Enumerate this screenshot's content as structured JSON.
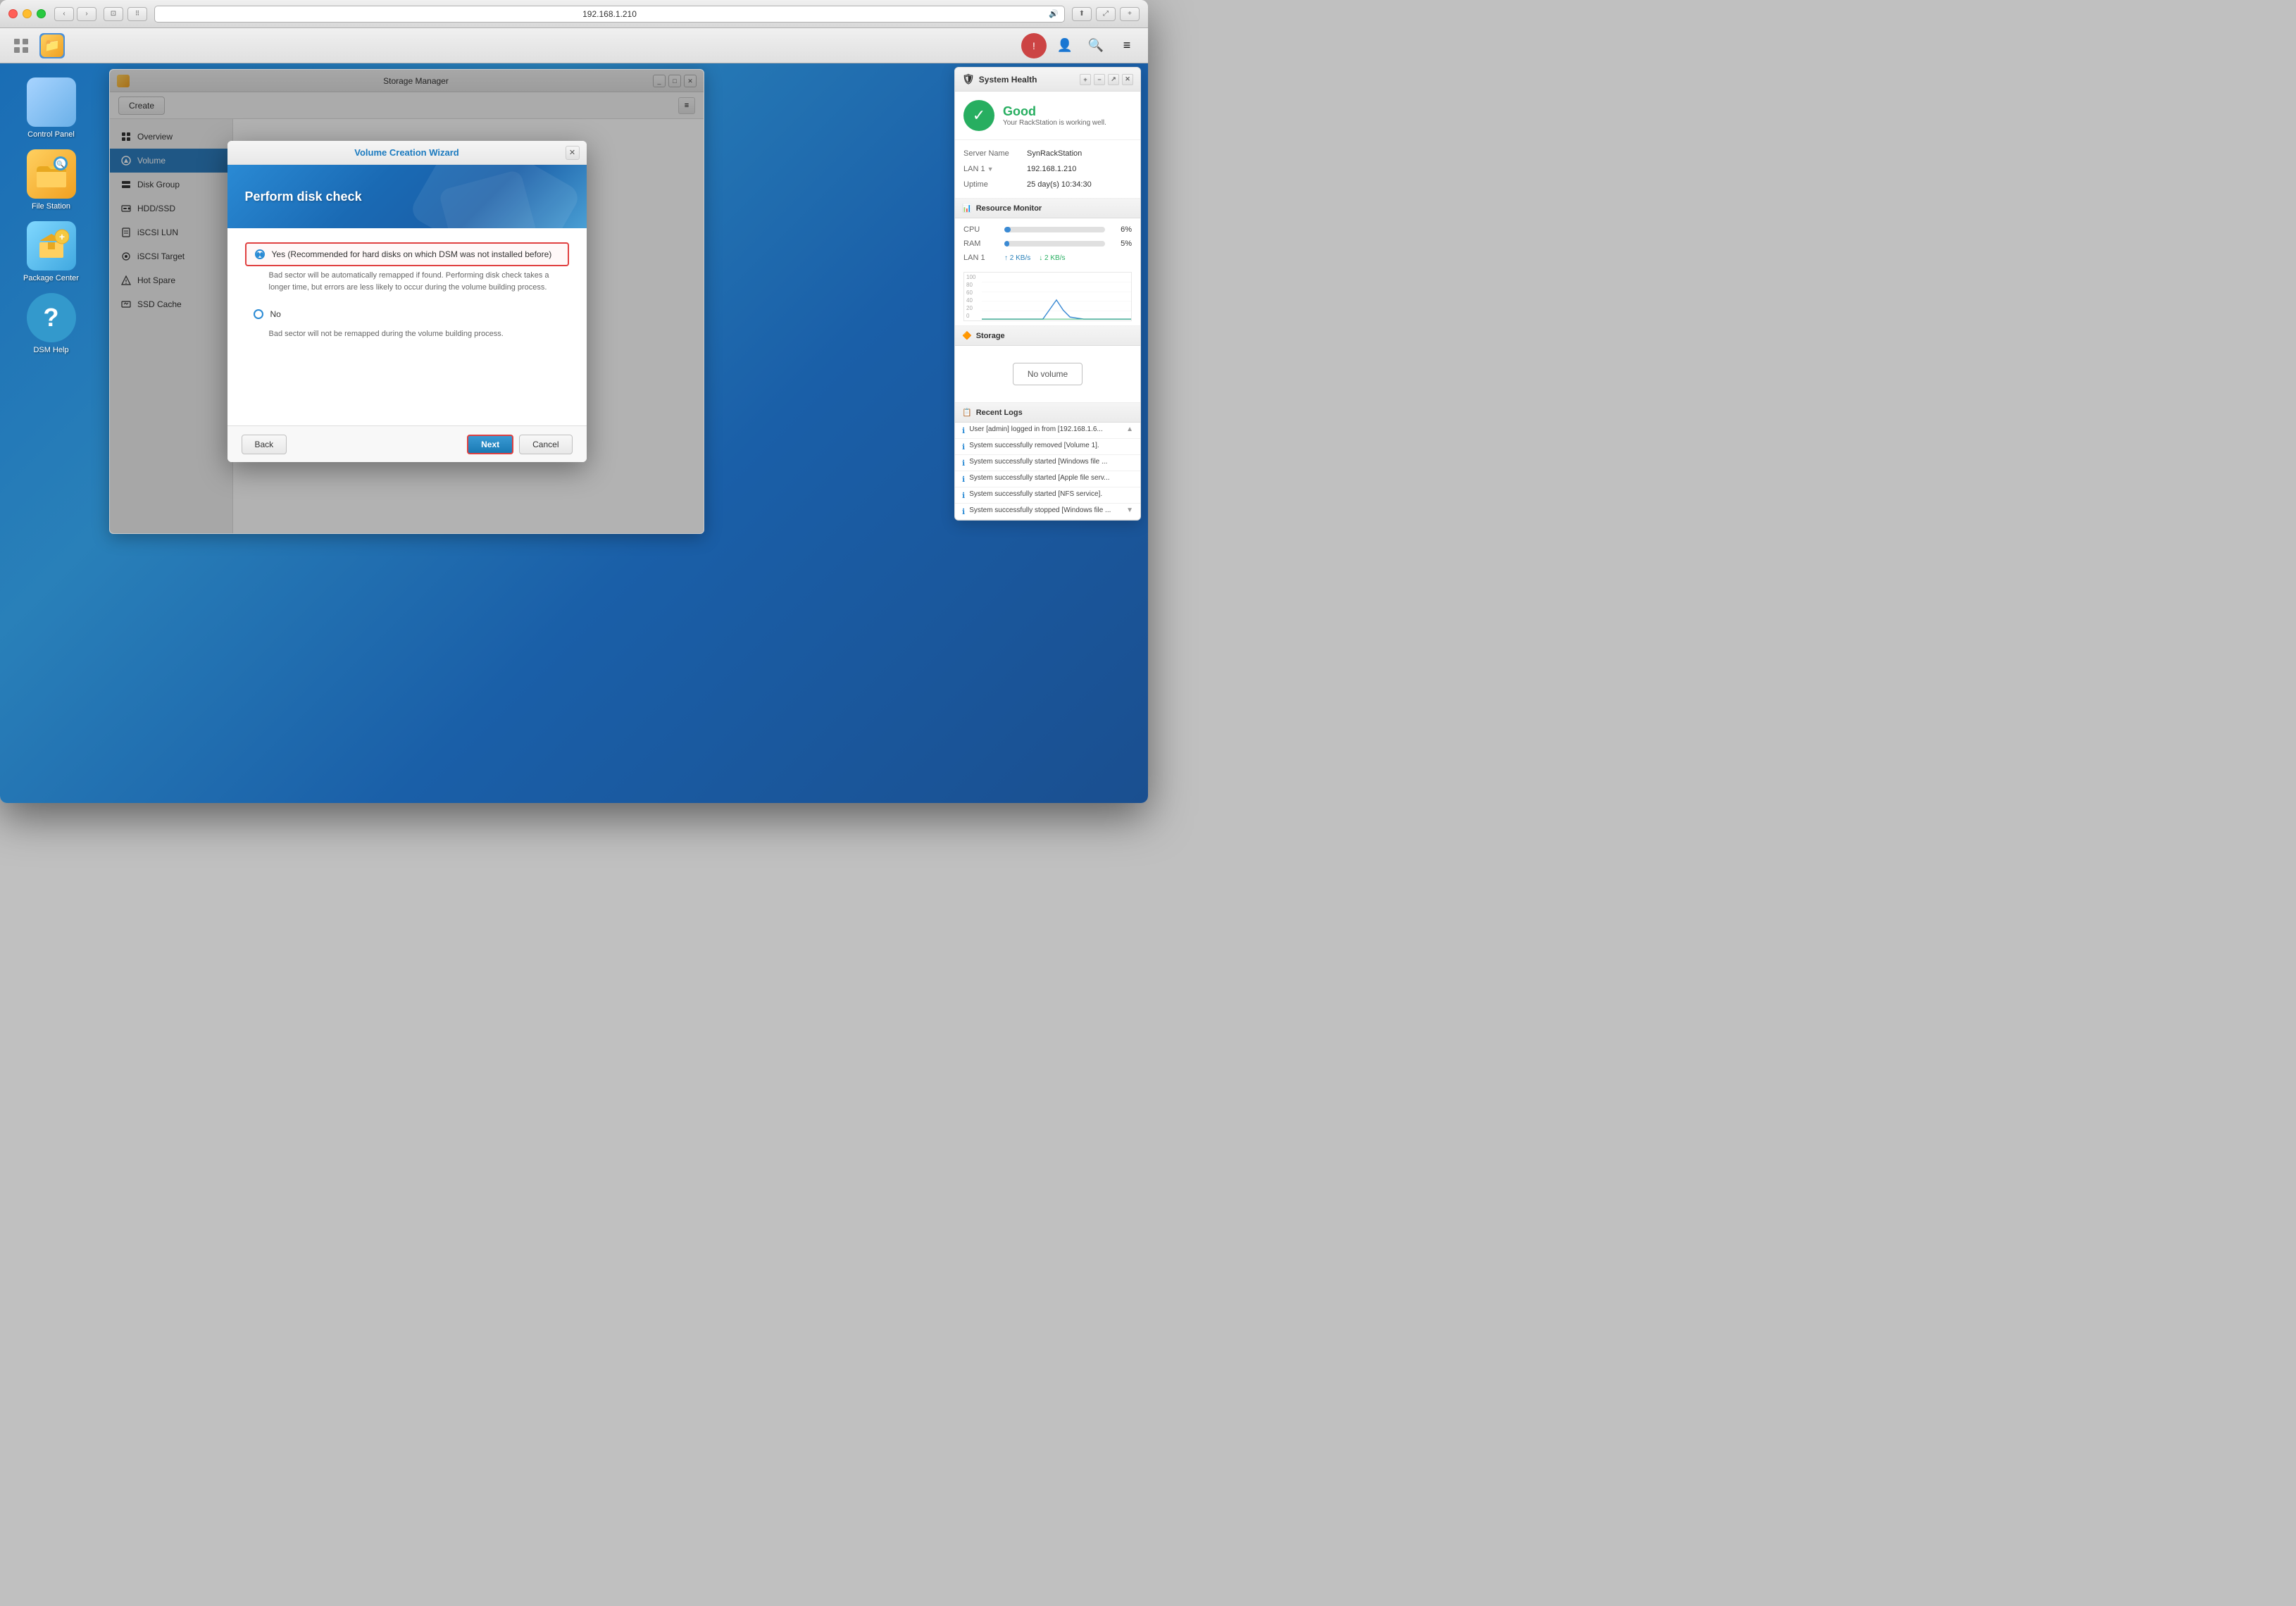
{
  "browser": {
    "title": "192.168.1.210",
    "back_btn": "‹",
    "forward_btn": "›",
    "window_btn": "⊡"
  },
  "toolbar": {
    "apps_icon": "⊞",
    "active_icon": "🗂",
    "right_icons": [
      "👤",
      "🔍",
      "≡"
    ]
  },
  "desktop_icons": [
    {
      "id": "control-panel",
      "label": "Control Panel"
    },
    {
      "id": "file-station",
      "label": "File Station"
    },
    {
      "id": "package-center",
      "label": "Package Center"
    },
    {
      "id": "dsm-help",
      "label": "DSM Help"
    }
  ],
  "storage_manager": {
    "title": "Storage Manager",
    "create_btn": "Create",
    "nav": [
      {
        "id": "overview",
        "label": "Overview",
        "active": false
      },
      {
        "id": "volume",
        "label": "Volume",
        "active": true
      },
      {
        "id": "disk-group",
        "label": "Disk Group",
        "active": false
      },
      {
        "id": "hdd-ssd",
        "label": "HDD/SSD",
        "active": false
      },
      {
        "id": "iscsi-lun",
        "label": "iSCSI LUN",
        "active": false
      },
      {
        "id": "iscsi-target",
        "label": "iSCSI Target",
        "active": false
      },
      {
        "id": "hot-spare",
        "label": "Hot Spare",
        "active": false
      },
      {
        "id": "ssd-cache",
        "label": "SSD Cache",
        "active": false
      }
    ]
  },
  "wizard": {
    "title": "Volume Creation Wizard",
    "header_title": "Perform disk check",
    "options": [
      {
        "id": "yes",
        "label": "Yes (Recommended for hard disks on which DSM was not installed before)",
        "description": "Bad sector will be automatically remapped if found. Performing disk check takes a longer time, but errors are less likely to occur during the volume building process.",
        "selected": true
      },
      {
        "id": "no",
        "label": "No",
        "description": "Bad sector will not be remapped during the volume building process.",
        "selected": false
      }
    ],
    "back_btn": "Back",
    "next_btn": "Next",
    "cancel_btn": "Cancel"
  },
  "system_health": {
    "title": "System Health",
    "status": "Good",
    "subtitle": "Your RackStation is working well.",
    "server_name_label": "Server Name",
    "server_name": "SynRackStation",
    "lan_label": "LAN 1",
    "lan_value": "192.168.1.210",
    "uptime_label": "Uptime",
    "uptime_value": "25 day(s) 10:34:30"
  },
  "resource_monitor": {
    "title": "Resource Monitor",
    "cpu_label": "CPU",
    "cpu_pct": "6%",
    "cpu_bar": 6,
    "ram_label": "RAM",
    "ram_pct": "5%",
    "ram_bar": 5,
    "lan_label": "LAN 1",
    "lan_up": "↑ 2 KB/s",
    "lan_down": "↓ 2 KB/s",
    "chart_y_labels": [
      "100",
      "80",
      "60",
      "40",
      "20",
      "0"
    ]
  },
  "storage": {
    "title": "Storage",
    "no_volume": "No volume"
  },
  "recent_logs": {
    "title": "Recent Logs",
    "items": [
      "User [admin] logged in from [192.168.1.6...",
      "System successfully removed [Volume 1].",
      "System successfully started [Windows file ...",
      "System successfully started [Apple file serv...",
      "System successfully started [NFS service].",
      "System successfully stopped [Windows file ..."
    ]
  }
}
